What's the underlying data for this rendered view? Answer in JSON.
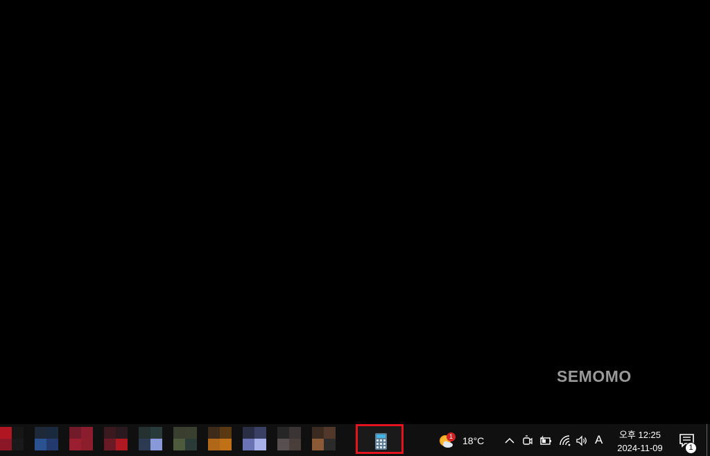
{
  "desktop": {
    "watermark": "SEMOMO"
  },
  "taskbar": {
    "pinned_apps": [
      {
        "name": "app-1",
        "colors": [
          "#b01622",
          "#161616",
          "#8b1726",
          "#1a1a1a"
        ]
      },
      {
        "name": "app-2",
        "colors": [
          "#1e2838",
          "#1a2a3c",
          "#2a5190",
          "#233a6e"
        ]
      },
      {
        "name": "app-3",
        "colors": [
          "#701a2a",
          "#8a1c2e",
          "#9a1e30",
          "#8c1d2b"
        ]
      },
      {
        "name": "app-4",
        "colors": [
          "#3a1a1e",
          "#2a1a20",
          "#6a1a24",
          "#b01822"
        ]
      },
      {
        "name": "app-5",
        "colors": [
          "#253030",
          "#283a3a",
          "#2c3a52",
          "#8898d8"
        ]
      },
      {
        "name": "app-6",
        "colors": [
          "#3a3e2e",
          "#3a4030",
          "#4e5a3c",
          "#2a3a36"
        ]
      },
      {
        "name": "app-7",
        "colors": [
          "#3e2a18",
          "#5a3812",
          "#b06818",
          "#c07016"
        ]
      },
      {
        "name": "app-8",
        "colors": [
          "#2a2e44",
          "#3a4064",
          "#6a74b4",
          "#a8b0ea"
        ]
      },
      {
        "name": "app-9",
        "colors": [
          "#262626",
          "#3a3434",
          "#585050",
          "#4a3e3a"
        ]
      },
      {
        "name": "app-10",
        "colors": [
          "#3a2a20",
          "#52382a",
          "#8a5a36",
          "#2a2a2a"
        ]
      }
    ],
    "highlighted_app": {
      "icon": "calculator-icon",
      "highlight_color": "#e2141d"
    },
    "weather": {
      "temperature": "18°C",
      "badge_count": "1",
      "icon": "sun-cloud-icon"
    },
    "tray_icons": [
      "chevron-up-icon",
      "meet-now-icon",
      "battery-icon",
      "wifi-icon",
      "volume-icon"
    ],
    "ime_indicator": "A",
    "clock": {
      "time": "오후 12:25",
      "date": "2024-11-09"
    },
    "notifications": {
      "icon": "notification-icon",
      "count": "1"
    }
  }
}
